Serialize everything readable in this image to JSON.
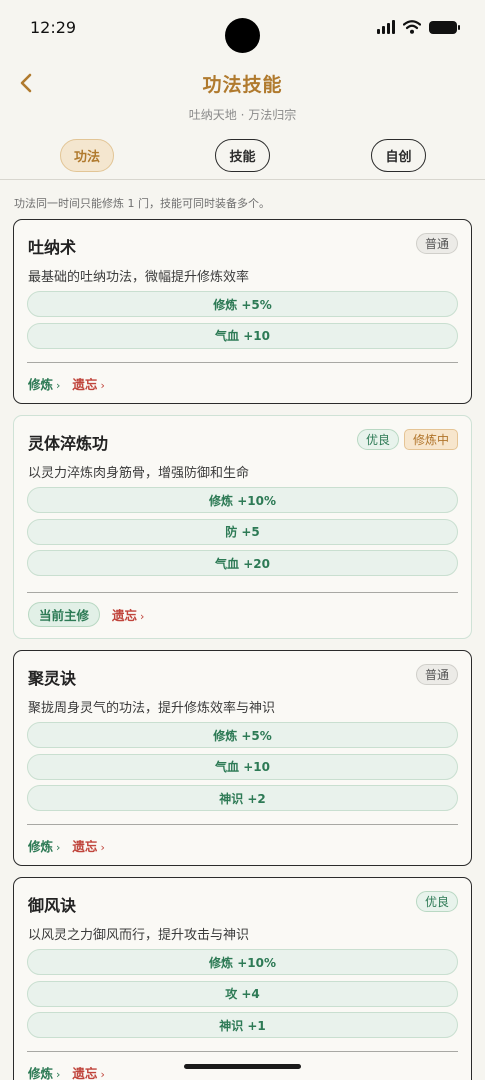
{
  "status": {
    "time": "12:29"
  },
  "header": {
    "title": "功法技能",
    "subtitle": "吐纳天地 · 万法归宗"
  },
  "tabs": [
    {
      "label": "功法",
      "active": true
    },
    {
      "label": "技能",
      "active": false
    },
    {
      "label": "自创",
      "active": false
    }
  ],
  "note": "功法同一时间只能修炼 1 门，技能可同时装备多个。",
  "cards": [
    {
      "name": "吐纳术",
      "badges": [
        "普通"
      ],
      "desc": "最基础的吐纳功法，微幅提升修炼效率",
      "stats": [
        "修炼 +5%",
        "气血 +10"
      ],
      "actions": {
        "train": "修炼",
        "forget": "遗忘",
        "arrow": "›"
      }
    },
    {
      "name": "灵体淬炼功",
      "badges": [
        "优良",
        "修炼中"
      ],
      "desc": "以灵力淬炼肉身筋骨，增强防御和生命",
      "stats": [
        "修炼 +10%",
        "防 +5",
        "气血 +20"
      ],
      "actions": {
        "current": "当前主修",
        "forget": "遗忘",
        "arrow": "›"
      }
    },
    {
      "name": "聚灵诀",
      "badges": [
        "普通"
      ],
      "desc": "聚拢周身灵气的功法，提升修炼效率与神识",
      "stats": [
        "修炼 +5%",
        "气血 +10",
        "神识 +2"
      ],
      "actions": {
        "train": "修炼",
        "forget": "遗忘",
        "arrow": "›"
      }
    },
    {
      "name": "御风诀",
      "badges": [
        "优良"
      ],
      "desc": "以风灵之力御风而行，提升攻击与神识",
      "stats": [
        "修炼 +10%",
        "攻 +4",
        "神识 +1"
      ],
      "actions": {
        "train": "修炼",
        "forget": "遗忘",
        "arrow": "›"
      }
    }
  ],
  "icons": {
    "back": "back-arrow-icon",
    "signal": "signal-icon",
    "wifi": "wifi-icon",
    "battery": "battery-icon"
  },
  "colors": {
    "accent": "#b07a2e",
    "green": "#2d7a55",
    "red": "#c0453c",
    "background": "#f6f5f0"
  }
}
